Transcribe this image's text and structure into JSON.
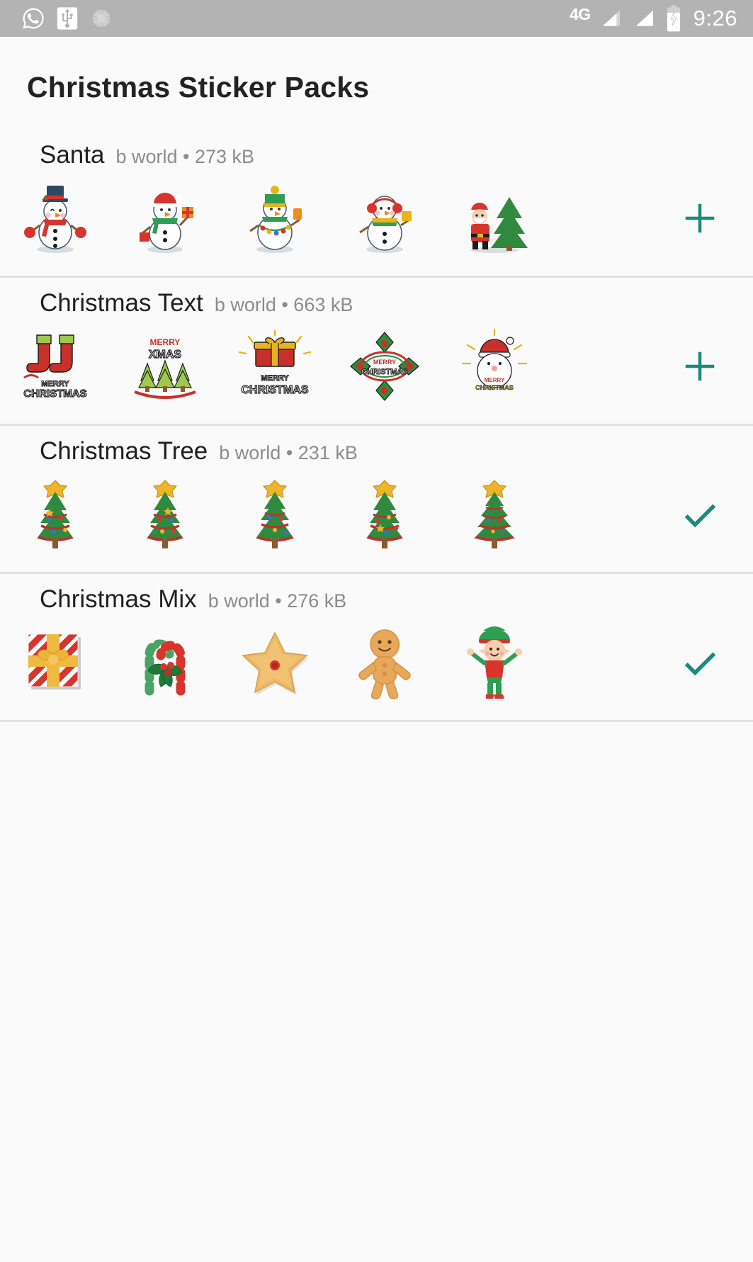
{
  "status_bar": {
    "left_icons": [
      "whatsapp-icon",
      "usb-icon",
      "dotted-circle-icon"
    ],
    "network_label": "4G",
    "signal_icons": [
      "signal-bars-1-icon",
      "signal-bars-2-icon"
    ],
    "battery_icon": "battery-charging-icon",
    "time": "9:26",
    "background_color": "#b3b3b3"
  },
  "header": {
    "title": "Christmas Sticker Packs"
  },
  "accent_color": "#1b8a7a",
  "packs": [
    {
      "name": "Santa",
      "meta": "b world • 273 kB",
      "publisher": "b world",
      "size": "273 kB",
      "action": "add",
      "action_label": "+",
      "action_icon": "plus-icon",
      "stickers": [
        "snowman-tophat",
        "snowman-gift",
        "snowman-lights",
        "snowman-earmuffs",
        "santa-tree"
      ]
    },
    {
      "name": "Christmas Text",
      "meta": "b world • 663 kB",
      "publisher": "b world",
      "size": "663 kB",
      "action": "add",
      "action_label": "+",
      "action_icon": "plus-icon",
      "stickers": [
        "stockings-merry-christmas",
        "merry-xmas-trees",
        "gift-merry-christmas",
        "merry-christmas-wreath",
        "santa-merry-christmas"
      ]
    },
    {
      "name": "Christmas Tree",
      "meta": "b world • 231 kB",
      "publisher": "b world",
      "size": "231 kB",
      "action": "added",
      "action_label": "✓",
      "action_icon": "check-icon",
      "stickers": [
        "xmas-tree-1",
        "xmas-tree-2",
        "xmas-tree-3",
        "xmas-tree-4",
        "xmas-tree-5"
      ]
    },
    {
      "name": "Christmas Mix",
      "meta": "b world • 276 kB",
      "publisher": "b world",
      "size": "276 kB",
      "action": "added",
      "action_label": "✓",
      "action_icon": "check-icon",
      "stickers": [
        "striped-gift-box",
        "candy-canes-holly",
        "star-cookie",
        "gingerbread-man",
        "elf"
      ]
    }
  ]
}
